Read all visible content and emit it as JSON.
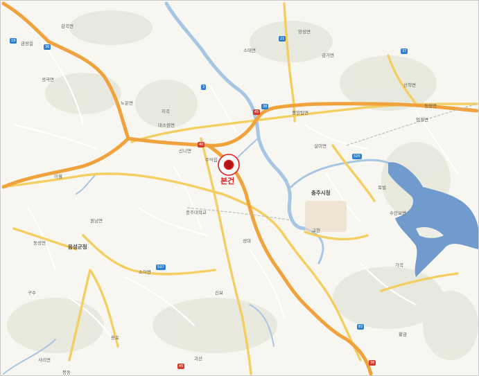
{
  "map": {
    "marker": {
      "label": "본건",
      "color": "#e21b1b"
    },
    "city_label": "충주시청",
    "town_label": "음성군청",
    "colors": {
      "background": "#f7f6f1",
      "land": "#eeeee6",
      "river": "#9fc0e0",
      "lake": "#6b97c9",
      "expressway": "#f0a23c",
      "national_road": "#f3cf62",
      "local_road": "#ffffff",
      "mountain": "#e4e6d8"
    },
    "labels": [
      {
        "id": "sogm",
        "text": "소태면"
      },
      {
        "id": "geumga",
        "text": "금가면"
      },
      {
        "id": "jungang",
        "text": "중앙탑면"
      },
      {
        "id": "daeso",
        "text": "대소원면"
      },
      {
        "id": "sinni",
        "text": "신니면"
      },
      {
        "id": "juduk",
        "text": "주덕읍"
      },
      {
        "id": "saemyeon",
        "text": "산척면"
      },
      {
        "id": "salmi",
        "text": "살미면"
      },
      {
        "id": "angseong",
        "text": "앙성면"
      },
      {
        "id": "noeun",
        "text": "노은면"
      },
      {
        "id": "soi",
        "text": "소이면"
      },
      {
        "id": "eomjeong",
        "text": "엄정면"
      },
      {
        "id": "suanbo",
        "text": "수안보면"
      },
      {
        "id": "gamgok",
        "text": "감곡면"
      },
      {
        "id": "saengguk",
        "text": "생극면"
      },
      {
        "id": "wonnam",
        "text": "원남면"
      },
      {
        "id": "dongseong",
        "text": "동성면"
      },
      {
        "id": "gyeonggi",
        "text": "금왕읍"
      },
      {
        "id": "dongnyang",
        "text": "동량면"
      },
      {
        "id": "jigi",
        "text": "지곡"
      },
      {
        "id": "sinbo",
        "text": "신보"
      },
      {
        "id": "ibo",
        "text": "이월"
      },
      {
        "id": "gwangsan",
        "text": "괴산"
      },
      {
        "id": "sahwa",
        "text": "사리면"
      },
      {
        "id": "bongdong",
        "text": "봉동"
      },
      {
        "id": "yongpo",
        "text": "용포"
      },
      {
        "id": "gusu",
        "text": "구수"
      },
      {
        "id": "gagok",
        "text": "가곡"
      },
      {
        "id": "mokbo",
        "text": "목벌"
      },
      {
        "id": "seongdae",
        "text": "성대"
      },
      {
        "id": "hwanggeum",
        "text": "황금"
      },
      {
        "id": "chungju_univ",
        "text": "충주대학교"
      },
      {
        "id": "gyohyeon",
        "text": "교현"
      }
    ],
    "shields": [
      {
        "text": "19",
        "type": "nat"
      },
      {
        "text": "36",
        "type": "nat"
      },
      {
        "text": "3",
        "type": "nat"
      },
      {
        "text": "38",
        "type": "nat"
      },
      {
        "text": "21",
        "type": "nat"
      },
      {
        "text": "37",
        "type": "nat"
      },
      {
        "text": "597",
        "type": "nat"
      },
      {
        "text": "82",
        "type": "nat"
      },
      {
        "text": "45",
        "type": "ex"
      },
      {
        "text": "40",
        "type": "ex"
      },
      {
        "text": "38",
        "type": "ex"
      },
      {
        "text": "45",
        "type": "ex"
      },
      {
        "text": "525",
        "type": "nat"
      }
    ]
  }
}
